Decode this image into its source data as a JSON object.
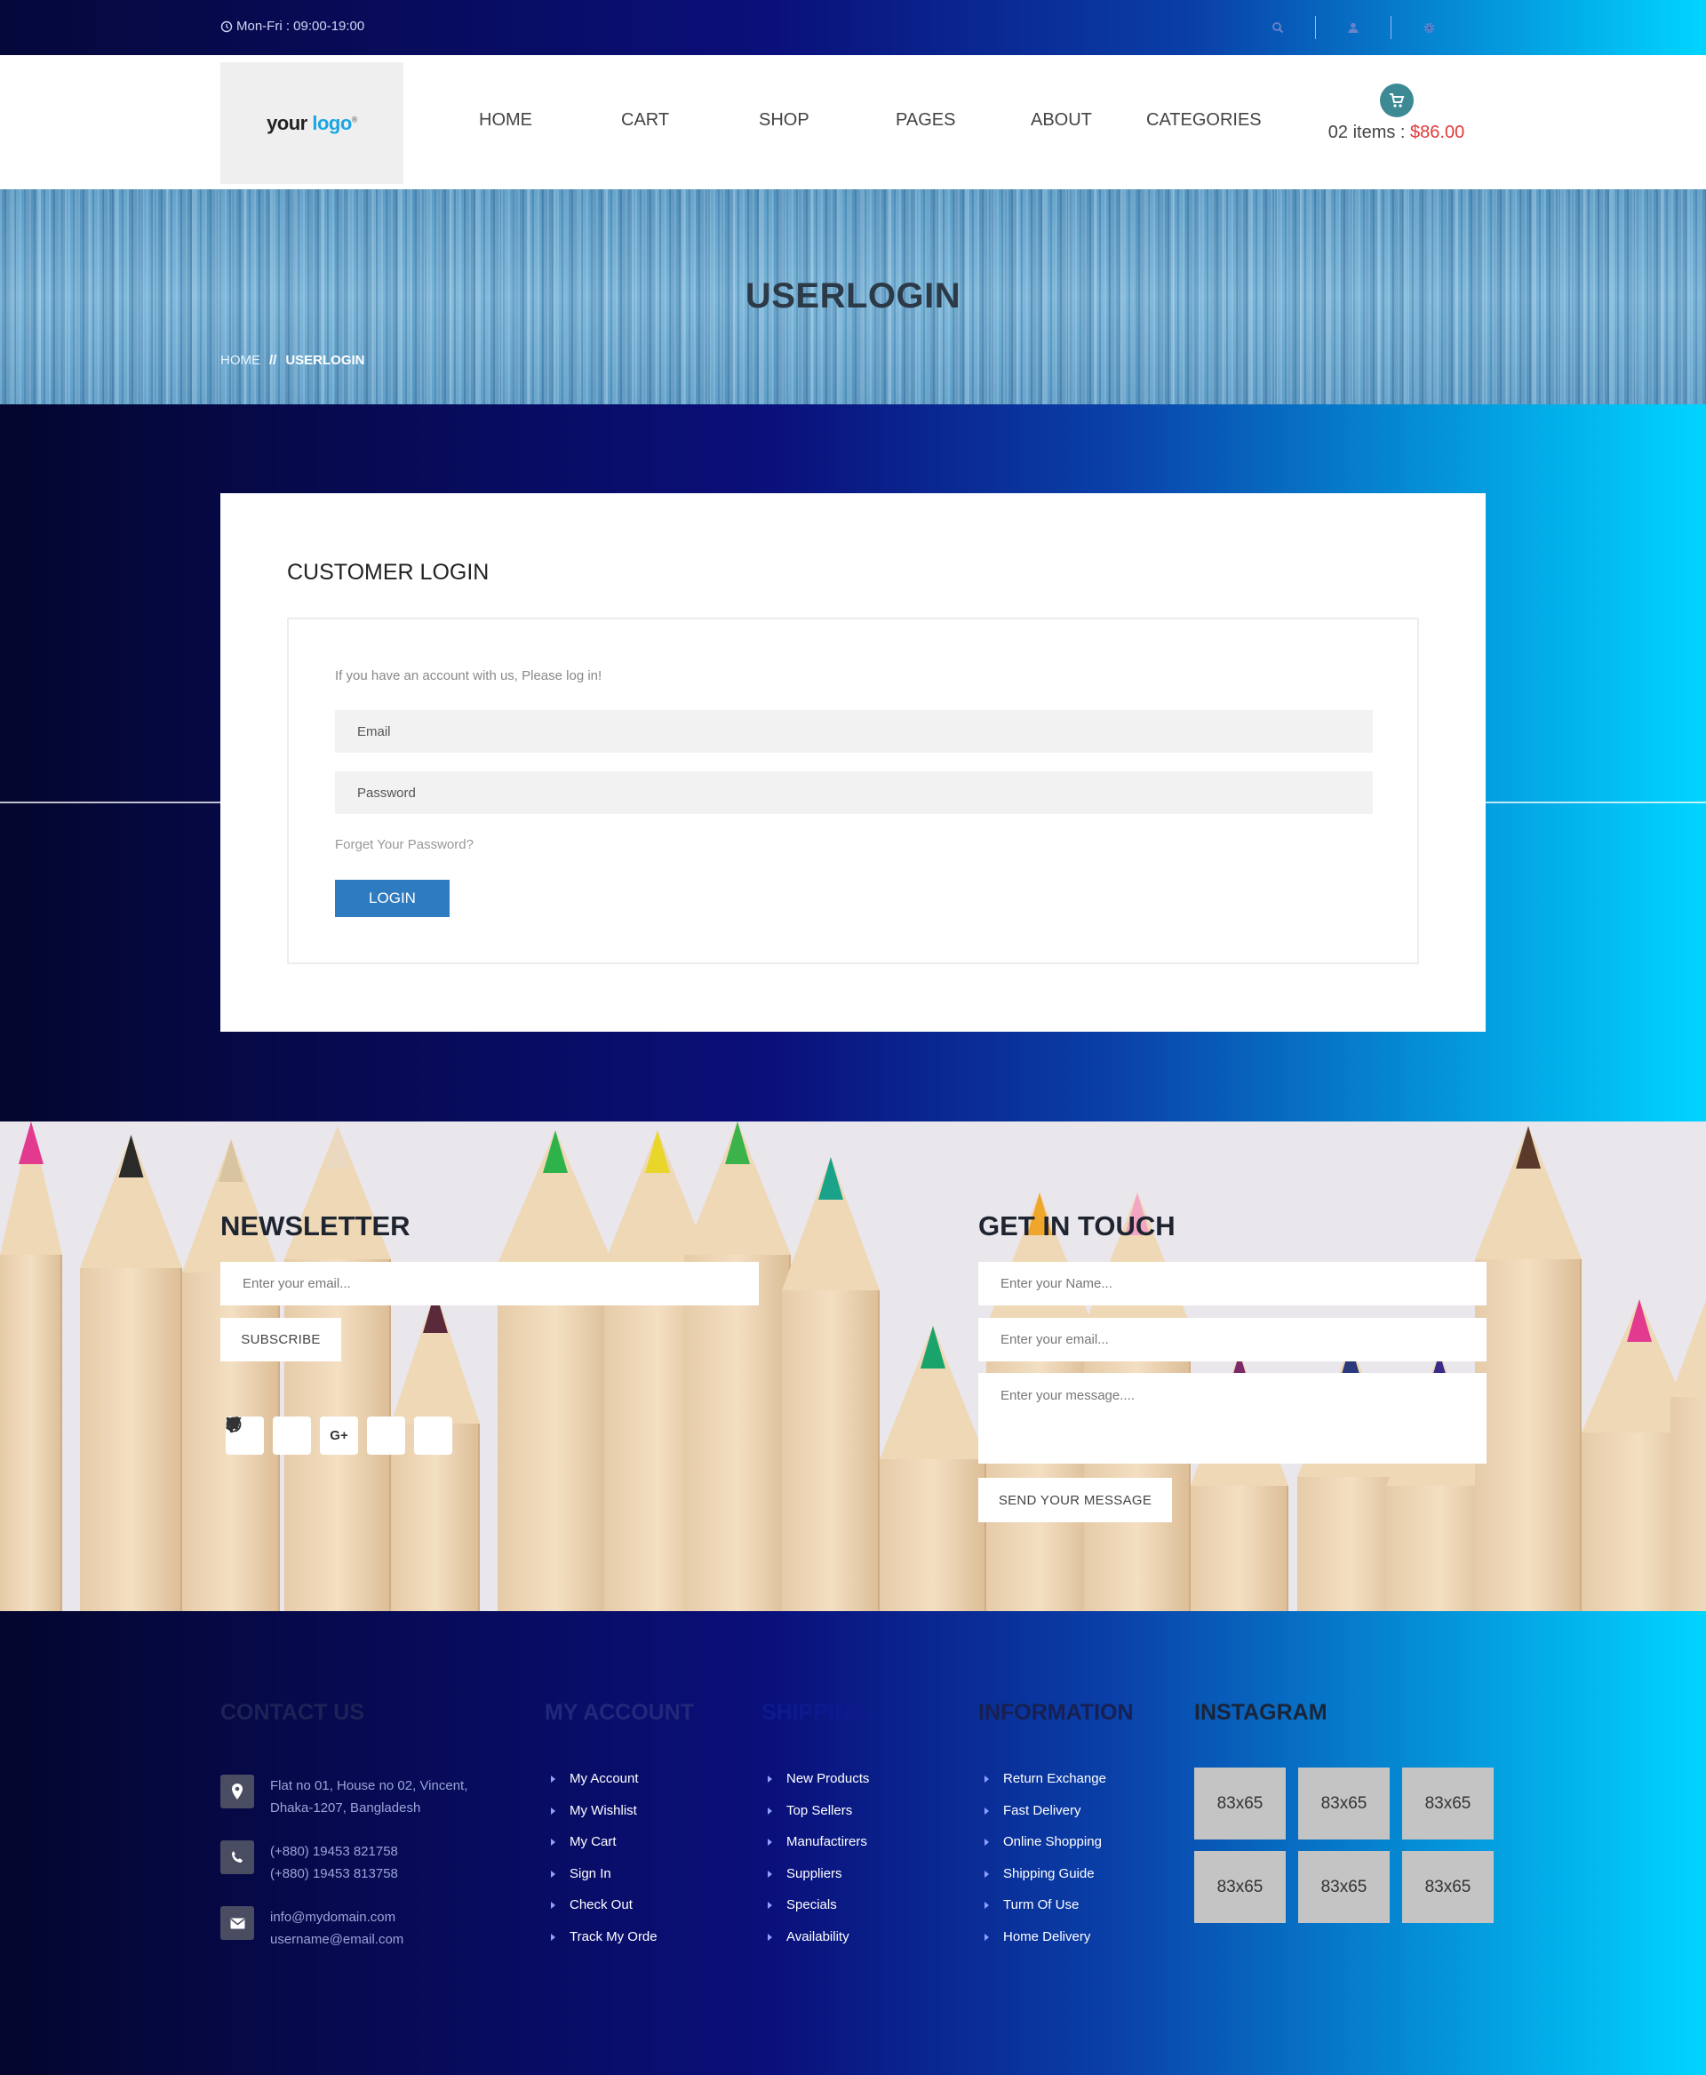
{
  "topbar": {
    "hours": "Mon-Fri : 09:00-19:00",
    "icons": [
      "search-icon",
      "user-icon",
      "gear-icon"
    ]
  },
  "header": {
    "logo": {
      "text_a": "your ",
      "text_b": "logo",
      "mark": "®"
    },
    "nav": [
      "HOME",
      "CART",
      "SHOP",
      "PAGES",
      "ABOUT",
      "CATEGORIES"
    ],
    "cart": {
      "count_label": "02 items : ",
      "total": "$86.00"
    }
  },
  "banner": {
    "title": "USERLOGIN",
    "breadcrumb": {
      "home": "HOME",
      "sep": "//",
      "current": "USERLOGIN"
    }
  },
  "login": {
    "title": "CUSTOMER LOGIN",
    "intro": "If you have an account with us, Please log in!",
    "email_placeholder": "Email",
    "password_placeholder": "Password",
    "forgot": "Forget Your Password?",
    "button": "LOGIN"
  },
  "newsletter": {
    "title": "NEWSLETTER",
    "email_placeholder": "Enter your email...",
    "button": "SUBSCRIBE",
    "socials": [
      "facebook-icon",
      "twitter-icon",
      "google-plus-icon",
      "dribbble-icon",
      "rss-icon"
    ],
    "gplus_glyph": "G+"
  },
  "contact_form": {
    "title": "GET IN TOUCH",
    "name_placeholder": "Enter your Name...",
    "email_placeholder": "Enter your email...",
    "message_placeholder": "Enter your message....",
    "button": "SEND YOUR MESSAGE"
  },
  "footer": {
    "contact": {
      "title": "CONTACT US",
      "address": [
        "Flat no 01, House no 02, Vincent,",
        "Dhaka-1207, Bangladesh"
      ],
      "phones": [
        "(+880) 19453 821758",
        "(+880) 19453 813758"
      ],
      "emails": [
        "info@mydomain.com",
        "username@email.com"
      ]
    },
    "account": {
      "title": "MY ACCOUNT",
      "items": [
        "My Account",
        "My Wishlist",
        "My Cart",
        "Sign In",
        "Check Out",
        "Track My Orde"
      ]
    },
    "shipping": {
      "title": "SHIPPING",
      "items": [
        "New Products",
        "Top Sellers",
        "Manufactirers",
        "Suppliers",
        "Specials",
        "Availability"
      ]
    },
    "information": {
      "title": "INFORMATION",
      "items": [
        "Return Exchange",
        "Fast Delivery",
        "Online Shopping",
        "Shipping Guide",
        "Turm Of Use",
        "Home Delivery"
      ]
    },
    "instagram": {
      "title": "INSTAGRAM",
      "tiles": [
        "83x65",
        "83x65",
        "83x65",
        "83x65",
        "83x65",
        "83x65"
      ]
    }
  }
}
